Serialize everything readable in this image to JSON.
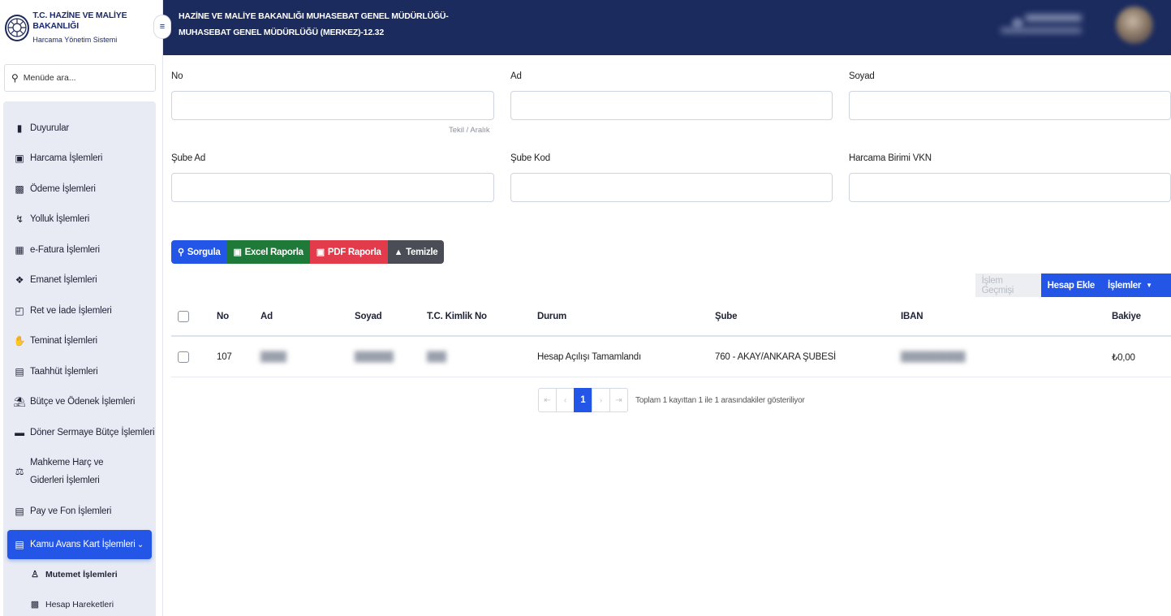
{
  "brand": {
    "title": "T.C. HAZİNE VE MALİYE BAKANLIĞI",
    "subtitle": "Harcama Yönetim Sistemi"
  },
  "header": {
    "line1": "HAZİNE VE MALİYE BAKANLIĞI MUHASEBAT GENEL MÜDÜRLÜĞÜ-",
    "line2": "MUHASEBAT GENEL MÜDÜRLÜĞÜ (MERKEZ)-12.32"
  },
  "sidebar": {
    "search_placeholder": "Menüde ara...",
    "items": [
      {
        "label": "Duyurular",
        "icon": "megaphone-icon"
      },
      {
        "label": "Harcama İşlemleri",
        "icon": "file-invoice-icon"
      },
      {
        "label": "Ödeme İşlemleri",
        "icon": "money-icon"
      },
      {
        "label": "Yolluk İşlemleri",
        "icon": "route-icon"
      },
      {
        "label": "e-Fatura İşlemleri",
        "icon": "receipt-icon"
      },
      {
        "label": "Emanet İşlemleri",
        "icon": "dropbox-icon"
      },
      {
        "label": "Ret ve İade İşlemleri",
        "icon": "undo-icon"
      },
      {
        "label": "Teminat İşlemleri",
        "icon": "hand-holding-icon"
      },
      {
        "label": "Taahhüt İşlemleri",
        "icon": "id-card-icon"
      },
      {
        "label": "Bütçe ve Ödenek İşlemleri",
        "icon": "bank-icon"
      },
      {
        "label": "Döner Sermaye Bütçe İşlemleri",
        "icon": "wallet-icon"
      },
      {
        "label": "Mahkeme Harç ve Giderleri İşlemleri",
        "icon": "scale-icon"
      },
      {
        "label": "Pay ve Fon İşlemleri",
        "icon": "list-card-icon"
      }
    ],
    "active_item": {
      "label": "Kamu Avans Kart İşlemleri",
      "icon": "credit-card-icon"
    },
    "sub_items": [
      {
        "label": "Mutemet İşlemleri",
        "icon": "user-icon"
      },
      {
        "label": "Hesap Hareketleri",
        "icon": "money-transfer-icon"
      }
    ]
  },
  "filters": {
    "no_label": "No",
    "ad_label": "Ad",
    "soyad_label": "Soyad",
    "no_hint": "Tekil  /  Aralık",
    "sube_ad_label": "Şube Ad",
    "sube_kod_label": "Şube Kod",
    "vkn_label": "Harcama Birimi VKN"
  },
  "buttons": {
    "sorgula": "Sorgula",
    "excel": "Excel Raporla",
    "pdf": "PDF Raporla",
    "temizle": "Temizle"
  },
  "actions": {
    "history": "İşlem Geçmişi",
    "add_account": "Hesap Ekle",
    "operations": "İşlemler"
  },
  "table": {
    "columns": [
      "No",
      "Ad",
      "Soyad",
      "T.C. Kimlik No",
      "Durum",
      "Şube",
      "IBAN",
      "Bakiye"
    ],
    "rows": [
      {
        "no": "107",
        "ad": "",
        "soyad": "",
        "tckn": "",
        "durum": "Hesap Açılışı Tamamlandı",
        "sube": "760 - AKAY/ANKARA ŞUBESİ",
        "iban": "",
        "bakiye": "₺0,00"
      }
    ]
  },
  "pagination": {
    "current_page": "1",
    "info": "Toplam 1 kayıttan 1 ile 1 arasındakiler gösteriliyor"
  },
  "colors": {
    "header_bg": "#1b2b5e",
    "primary": "#2355e6",
    "excel": "#1f7a3a",
    "pdf": "#e23b4c",
    "clear": "#4a4d55",
    "sidebar_menu_bg": "#e8ebf4"
  }
}
